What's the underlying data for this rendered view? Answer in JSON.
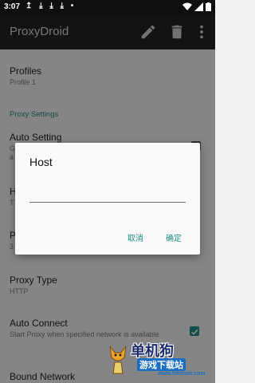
{
  "status_bar": {
    "time": "3:07",
    "notification_glyphs": "↥ ⤓ ⤓ ⤓ •",
    "icons": [
      "wifi-icon",
      "signal-icon",
      "battery-icon"
    ]
  },
  "toolbar": {
    "title": "ProxyDroid",
    "actions": [
      "edit-icon",
      "delete-icon",
      "more-vert-icon"
    ]
  },
  "preferences": {
    "profiles": {
      "title": "Profiles",
      "summary": "Profile 1"
    },
    "section_proxy": "Proxy Settings",
    "auto_setting": {
      "title": "Auto Setting",
      "summary_fragment": "G",
      "summary_fragment2": "a"
    },
    "host_fragment": "H",
    "host_summary_fragment": "T",
    "port_fragment": "P",
    "port_summary_fragment": "3",
    "proxy_type": {
      "title": "Proxy Type",
      "summary": "HTTP"
    },
    "auto_connect": {
      "title": "Auto Connect",
      "summary": "Start Proxy when specified network is available",
      "checked": true
    },
    "bound_network": {
      "title": "Bound Network"
    }
  },
  "dialog": {
    "title": "Host",
    "input_value": "",
    "cancel_label": "取消",
    "ok_label": "确定"
  },
  "watermark": {
    "main": "单机狗",
    "sub": "游戏下载站",
    "url": "www.fotimeit.com"
  },
  "colors": {
    "accent": "#1f8f81",
    "toolbar_bg": "#242424",
    "statusbar_bg": "#0f0f0f"
  }
}
